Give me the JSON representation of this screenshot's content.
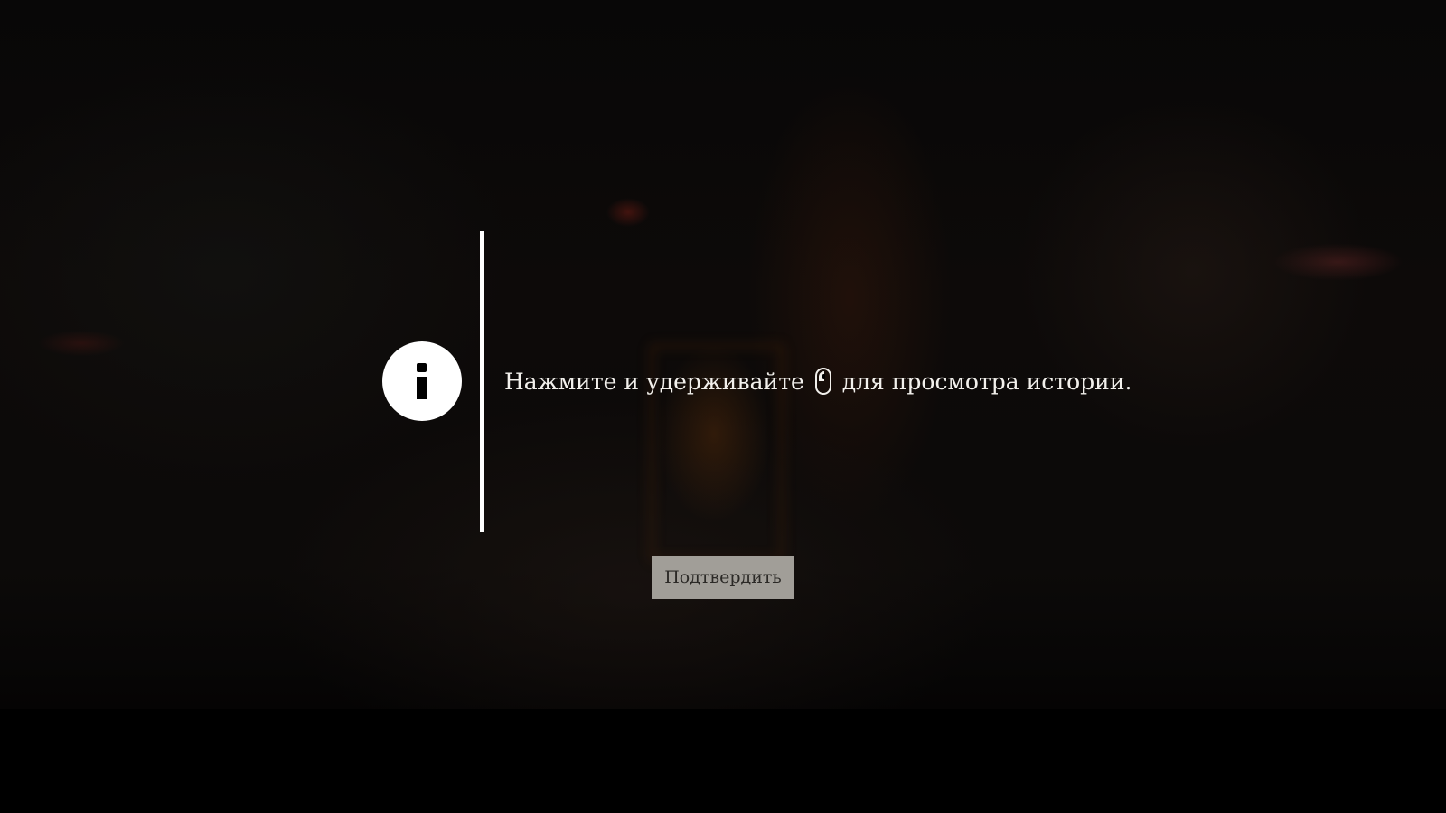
{
  "dialog": {
    "message_before": "Нажмите и удерживайте",
    "message_after": "для просмотра истории.",
    "confirm_label": "Подтвердить",
    "icons": {
      "info": "info-icon",
      "mouse": "mouse-left-button-icon"
    }
  },
  "colors": {
    "text": "#f2f0ec",
    "button_background": "#a19e98",
    "button_text": "#2b2926",
    "icon": "#ffffff"
  }
}
